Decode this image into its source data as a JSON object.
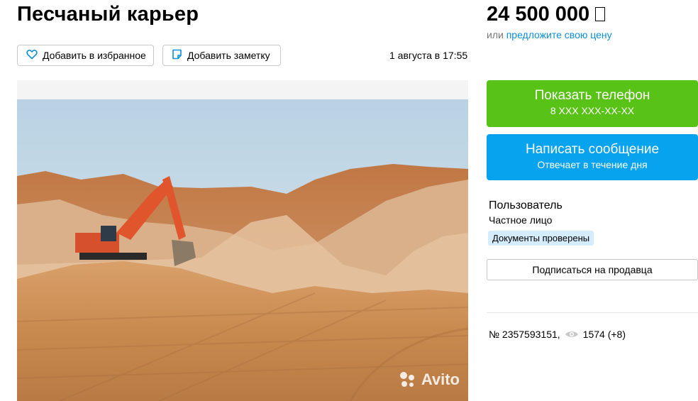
{
  "listing": {
    "title": "Песчаный карьер",
    "price": "24 500 000",
    "currency_icon": "ruble-icon",
    "offer_prefix": "или",
    "offer_link": "предложите свою цену",
    "date": "1 августа в 17:55",
    "id_text": "№ 2357593151,",
    "views": "1574 (+8)"
  },
  "actions": {
    "favorite_label": "Добавить в избранное",
    "note_label": "Добавить заметку"
  },
  "contact": {
    "phone_label": "Показать телефон",
    "phone_masked": "8 XXX XXX-XX-XX",
    "message_label": "Написать сообщение",
    "message_sub": "Отвечает в течение дня"
  },
  "seller": {
    "name": "Пользователь",
    "type": "Частное лицо",
    "badge": "Документы проверены",
    "subscribe_label": "Подписаться на продавца"
  },
  "photo": {
    "watermark": "Avito",
    "description_icon": "quarry-photo"
  },
  "colors": {
    "phone_button": "#58c316",
    "message_button": "#08a3ef",
    "link": "#0a8fd8",
    "badge": "#d4ecfb"
  }
}
